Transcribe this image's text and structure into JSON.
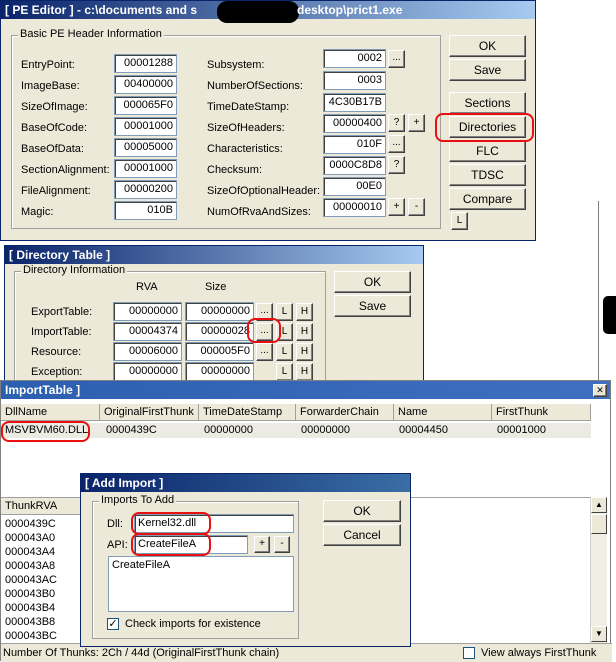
{
  "pe_editor": {
    "title": "[ PE Editor ] - c:\\documents and s",
    "title_right": "desktop\\prict1.exe",
    "group_title": "Basic PE Header Information",
    "left_fields": [
      {
        "label": "EntryPoint:",
        "value": "00001288"
      },
      {
        "label": "ImageBase:",
        "value": "00400000"
      },
      {
        "label": "SizeOfImage:",
        "value": "000065F0"
      },
      {
        "label": "BaseOfCode:",
        "value": "00001000"
      },
      {
        "label": "BaseOfData:",
        "value": "00005000"
      },
      {
        "label": "SectionAlignment:",
        "value": "00001000"
      },
      {
        "label": "FileAlignment:",
        "value": "00000200"
      },
      {
        "label": "Magic:",
        "value": "010B"
      }
    ],
    "right_fields": [
      {
        "label": "Subsystem:",
        "value": "0002"
      },
      {
        "label": "NumberOfSections:",
        "value": "0003"
      },
      {
        "label": "TimeDateStamp:",
        "value": "4C30B17B"
      },
      {
        "label": "SizeOfHeaders:",
        "value": "00000400"
      },
      {
        "label": "Characteristics:",
        "value": "010F"
      },
      {
        "label": "Checksum:",
        "value": "0000C8D8"
      },
      {
        "label": "SizeOfOptionalHeader:",
        "value": "00E0"
      },
      {
        "label": "NumOfRvaAndSizes:",
        "value": "00000010"
      }
    ],
    "small_btns": {
      "dots": "...",
      "q": "?",
      "plus": "+",
      "minus": "-",
      "l": "L"
    },
    "buttons": {
      "ok": "OK",
      "save": "Save",
      "sections": "Sections",
      "directories": "Directories",
      "flc": "FLC",
      "tdsc": "TDSC",
      "compare": "Compare"
    }
  },
  "directory_table": {
    "title": "[ Directory Table ]",
    "group_title": "Directory Information",
    "col_rva": "RVA",
    "col_size": "Size",
    "rows": [
      {
        "label": "ExportTable:",
        "rva": "00000000",
        "size": "00000000"
      },
      {
        "label": "ImportTable:",
        "rva": "00004374",
        "size": "00000028"
      },
      {
        "label": "Resource:",
        "rva": "00006000",
        "size": "000005F0"
      },
      {
        "label": "Exception:",
        "rva": "00000000",
        "size": "00000000"
      }
    ],
    "btn_dots": "...",
    "btn_l": "L",
    "btn_h": "H",
    "ok": "OK",
    "save": "Save"
  },
  "import_table": {
    "title": "ImportTable ]",
    "close": "✕",
    "headers": [
      "DllName",
      "OriginalFirstThunk",
      "TimeDateStamp",
      "ForwarderChain",
      "Name",
      "FirstThunk"
    ],
    "row": [
      "MSVBVM60.DLL",
      "0000439C",
      "00000000",
      "00000000",
      "00004450",
      "00001000"
    ],
    "thunk_header": "ThunkRVA",
    "thunks": [
      "0000439C",
      "000043A0",
      "000043A4",
      "000043A8",
      "000043AC",
      "000043B0",
      "000043B4",
      "000043B8",
      "000043BC"
    ],
    "status": "Number Of Thunks: 2Ch / 44d (OriginalFirstThunk chain)",
    "view_always": "View always FirstThunk"
  },
  "add_import": {
    "title": "[ Add Import ]",
    "group_title": "Imports To Add",
    "dll_label": "Dll:",
    "dll_value": "Kernel32.dll",
    "api_label": "API:",
    "api_value": "CreateFileA",
    "plus": "+",
    "minus": "-",
    "list": [
      "CreateFileA"
    ],
    "check_label": "Check imports for existence",
    "ok": "OK",
    "cancel": "Cancel"
  }
}
